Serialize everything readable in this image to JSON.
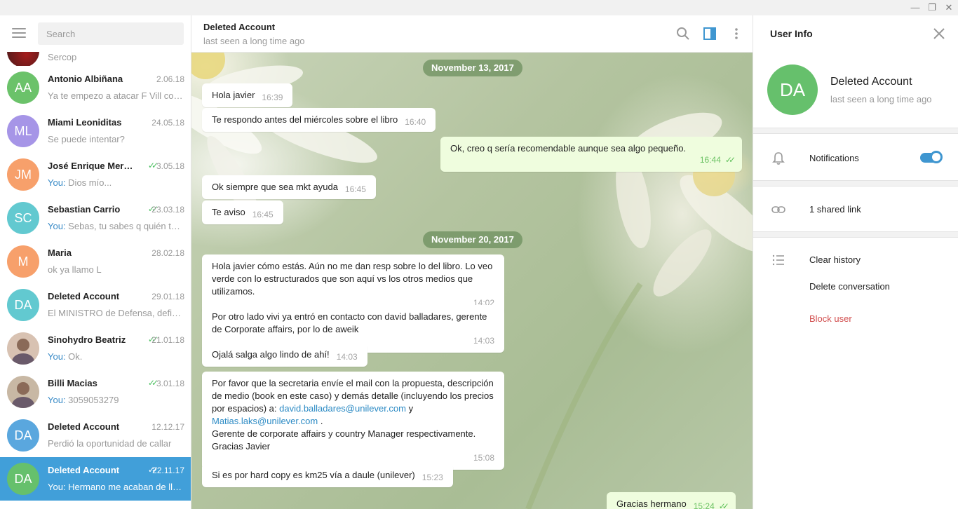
{
  "window": {
    "minimize": "—",
    "restore": "❐",
    "close": "✕"
  },
  "sidebar": {
    "search_placeholder": "Search",
    "partial_preview": "Sercop",
    "chats": [
      {
        "initials": "AA",
        "color": "#6bc26a",
        "name": "Antonio Albiñana",
        "date": "2.06.18",
        "check": "",
        "you": "",
        "preview": "Ya te empezo a atacar F Vill con el tema..."
      },
      {
        "initials": "ML",
        "color": "#a695e7",
        "name": "Miami Leoniditas",
        "date": "24.05.18",
        "check": "",
        "you": "",
        "preview": "Se puede intentar?"
      },
      {
        "initials": "JM",
        "color": "#f7a06b",
        "name": "José Enrique Mercado",
        "date": "3.05.18",
        "check": "✓✓",
        "you": "You: ",
        "preview": "Dios mío..."
      },
      {
        "initials": "SC",
        "color": "#62c9d0",
        "name": "Sebastian Carrio",
        "date": "23.03.18",
        "check": "✓✓",
        "you": "You: ",
        "preview": "Sebas, tu sabes q quién te queda..."
      },
      {
        "initials": "M",
        "color": "#f7a06b",
        "name": "Maria",
        "date": "28.02.18",
        "check": "",
        "you": "",
        "preview": "ok ya llamo L"
      },
      {
        "initials": "DA",
        "color": "#62c9d0",
        "name": "Deleted Account",
        "date": "29.01.18",
        "check": "",
        "you": "",
        "preview": "El MINISTRO de Defensa, definiendo..."
      },
      {
        "initials": "",
        "color": "#d8c2b2",
        "name": "Sinohydro Beatriz",
        "date": "21.01.18",
        "check": "✓✓",
        "you": "You: ",
        "preview": "Ok."
      },
      {
        "initials": "",
        "color": "#c8b8a4",
        "name": "Billi Macias",
        "date": "3.01.18",
        "check": "✓✓",
        "you": "You: ",
        "preview": "3059053279"
      },
      {
        "initials": "DA",
        "color": "#5aa7de",
        "name": "Deleted Account",
        "date": "12.12.17",
        "check": "",
        "you": "",
        "preview": "Perdió la oportunidad de callar"
      },
      {
        "initials": "DA",
        "color": "#66c06c",
        "name": "Deleted Account",
        "date": "22.11.17",
        "check": "✓✓",
        "you": "",
        "preview": "You: Hermano me acaban de llamar..."
      }
    ]
  },
  "header": {
    "title": "Deleted Account",
    "subtitle": "last seen a long time ago"
  },
  "messages": {
    "date1": "November 13, 2017",
    "m1": {
      "text": "Hola javier",
      "time": "16:39"
    },
    "m2": {
      "text": "Te respondo antes del miércoles sobre el libro",
      "time": "16:40"
    },
    "m3": {
      "text": "Ok, creo q sería recomendable aunque sea algo pequeño.",
      "time": "16:44",
      "check": "✓✓"
    },
    "m4": {
      "text": "Ok siempre que sea mkt ayuda",
      "time": "16:45"
    },
    "m5": {
      "text": "Te aviso",
      "time": "16:45"
    },
    "date2": "November 20, 2017",
    "m6": {
      "text": "Hola javier cómo estás. Aún no me dan resp sobre lo del libro. Lo veo verde con lo estructurados que son aquí vs los otros medios que utilizamos.",
      "time": "14:02"
    },
    "m7": {
      "text": "Por otro lado vivi ya entró en contacto con david balladares, gerente de Corporate affairs, por lo de aweik",
      "time": "14:03"
    },
    "m8": {
      "text": "Ojalá salga algo lindo de ahí!",
      "time": "14:03"
    },
    "m9": {
      "text1": "Por favor que la secretaria envíe el mail con la propuesta, descripción de medio (book en este caso) y demás detalle (incluyendo los precios por espacios) a:",
      "email1": "david.balladares@unilever.com",
      "joiner": "y",
      "email2": "Matias.laks@unilever.com",
      "dot": ".",
      "text2": "Gerente de corporate affairs y country Manager respectivamente.",
      "text3": "Gracias Javier",
      "time": "15:08"
    },
    "m10": {
      "text": "Si es por hard copy es km25 vía a daule (unilever)",
      "time": "15:23"
    },
    "m11": {
      "text": "Gracias hermano",
      "time": "15:24",
      "check": "✓✓"
    }
  },
  "info": {
    "title": "User Info",
    "initials": "DA",
    "name": "Deleted Account",
    "status": "last seen a long time ago",
    "notifications": "Notifications",
    "notifications_on": true,
    "shared_links": "1 shared link",
    "clear_history": "Clear history",
    "delete_conversation": "Delete conversation",
    "block_user": "Block user"
  }
}
